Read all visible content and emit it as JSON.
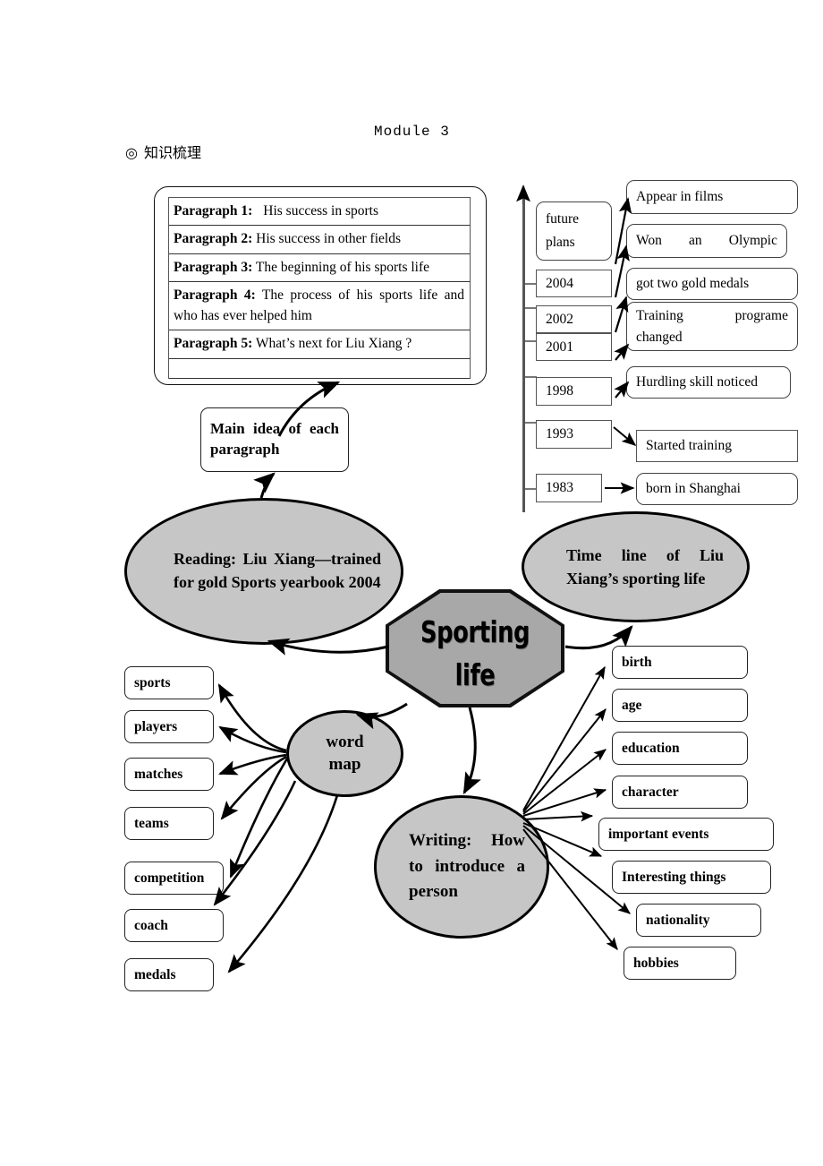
{
  "header": {
    "module_title": "Module 3",
    "section_marker": "◎",
    "section_label": "知识梳理"
  },
  "paragraph_card": {
    "rows": [
      {
        "label": "Paragraph 1:",
        "text": "His success in sports"
      },
      {
        "label": "Paragraph 2:",
        "text": "His success in other fields"
      },
      {
        "label": "Paragraph 3:",
        "text": "The beginning of his sports life"
      },
      {
        "label": "Paragraph 4:",
        "text": "The process of his sports life and who has ever helped him"
      },
      {
        "label": "Paragraph 5:",
        "text": "What’s next for Liu Xiang ?"
      }
    ]
  },
  "main_idea_box": {
    "label": "Main idea of each paragraph"
  },
  "nodes": {
    "reading": "Reading: Liu Xiang—trained for gold Sports yearbook 2004",
    "timeline": "Time line of Liu Xiang’s sporting life",
    "center": {
      "line1": "Sporting",
      "line2": "life"
    },
    "word_map": {
      "line1": "word",
      "line2": "map"
    },
    "writing": "Writing: How to introduce a person"
  },
  "timeline": {
    "years": [
      {
        "year": "future plans",
        "multiline": true
      },
      {
        "year": "2004"
      },
      {
        "year": "2002"
      },
      {
        "year": "2001"
      },
      {
        "year": "1998"
      },
      {
        "year": "1993"
      },
      {
        "year": "1983"
      }
    ],
    "events": [
      {
        "text": "Appear in films"
      },
      {
        "text": "Won an Olympic"
      },
      {
        "text": "got two gold medals"
      },
      {
        "text": "Training programe changed"
      },
      {
        "text": "Hurdling skill noticed"
      },
      {
        "text": "Started training"
      },
      {
        "text": "born in Shanghai"
      }
    ]
  },
  "word_map_items": [
    {
      "label": "sports"
    },
    {
      "label": "players"
    },
    {
      "label": "matches"
    },
    {
      "label": "teams"
    },
    {
      "label": "competition"
    },
    {
      "label": "coach"
    },
    {
      "label": "medals"
    }
  ],
  "writing_items": [
    {
      "label": "birth"
    },
    {
      "label": "age"
    },
    {
      "label": "education"
    },
    {
      "label": "character"
    },
    {
      "label": "important events"
    },
    {
      "label": "Interesting things"
    },
    {
      "label": "nationality"
    },
    {
      "label": "hobbies"
    }
  ],
  "colors": {
    "ellipse_fill": "#c6c6c6",
    "octagon_fill": "#a8a8a8",
    "line": "#000000",
    "box_border": "#444444"
  }
}
